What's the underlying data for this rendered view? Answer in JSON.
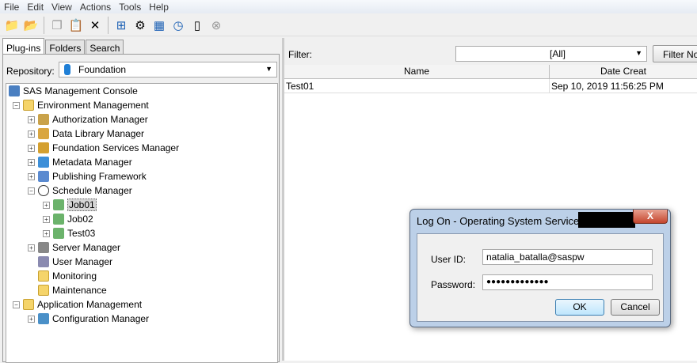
{
  "menu": [
    "File",
    "Edit",
    "View",
    "Actions",
    "Tools",
    "Help"
  ],
  "toolbar": [
    {
      "icon": "up-folder-icon",
      "g": "📁"
    },
    {
      "icon": "open-folder-icon",
      "g": "📂"
    },
    {
      "sep": true
    },
    {
      "icon": "copy-icon",
      "g": "❐"
    },
    {
      "icon": "paste-icon",
      "g": "📋"
    },
    {
      "icon": "delete-icon",
      "g": "✕"
    },
    {
      "sep": true
    },
    {
      "icon": "flow-icon",
      "g": "⊞"
    },
    {
      "icon": "gear-icon",
      "g": "⚙"
    },
    {
      "icon": "deploy-icon",
      "g": "▦"
    },
    {
      "icon": "clock-icon",
      "g": "◷"
    },
    {
      "icon": "server-icon",
      "g": "▯"
    },
    {
      "icon": "stop-icon",
      "g": "⊗"
    }
  ],
  "tabs": [
    "Plug-ins",
    "Folders",
    "Search"
  ],
  "repository": {
    "label": "Repository:",
    "value": "Foundation"
  },
  "tree": [
    {
      "label": "SAS Management Console",
      "level": 0,
      "exp": "",
      "icon": "console"
    },
    {
      "label": "Environment Management",
      "level": 1,
      "exp": "−",
      "icon": "folder"
    },
    {
      "label": "Authorization Manager",
      "level": 2,
      "exp": "+",
      "icon": "auth"
    },
    {
      "label": "Data Library Manager",
      "level": 2,
      "exp": "+",
      "icon": "lib"
    },
    {
      "label": "Foundation Services Manager",
      "level": 2,
      "exp": "+",
      "icon": "svc"
    },
    {
      "label": "Metadata Manager",
      "level": 2,
      "exp": "+",
      "icon": "meta"
    },
    {
      "label": "Publishing Framework",
      "level": 2,
      "exp": "+",
      "icon": "pub"
    },
    {
      "label": "Schedule Manager",
      "level": 2,
      "exp": "−",
      "icon": "clock"
    },
    {
      "label": "Job01",
      "level": 3,
      "exp": "+",
      "icon": "job",
      "selected": true
    },
    {
      "label": "Job02",
      "level": 3,
      "exp": "+",
      "icon": "job"
    },
    {
      "label": "Test03",
      "level": 3,
      "exp": "+",
      "icon": "job"
    },
    {
      "label": "Server Manager",
      "level": 2,
      "exp": "+",
      "icon": "server"
    },
    {
      "label": "User Manager",
      "level": 2,
      "exp": "",
      "icon": "user"
    },
    {
      "label": "Monitoring",
      "level": 2,
      "exp": "",
      "icon": "folder"
    },
    {
      "label": "Maintenance",
      "level": 2,
      "exp": "",
      "icon": "folder"
    },
    {
      "label": "Application Management",
      "level": 1,
      "exp": "−",
      "icon": "folder"
    },
    {
      "label": "Configuration Manager",
      "level": 2,
      "exp": "+",
      "icon": "config"
    }
  ],
  "filter": {
    "label": "Filter:",
    "value": "[All]",
    "button": "Filter Now"
  },
  "table": {
    "columns": [
      "Name",
      "Date Creat"
    ],
    "rows": [
      [
        "Test01",
        "Sep 10, 2019 11:56:25 PM"
      ]
    ]
  },
  "dialog": {
    "title": "Log On - Operating System Services - u",
    "close": "X",
    "user_label": "User ID:",
    "user_value": "natalia_batalla@saspw",
    "password_label": "Password:",
    "password_value": "●●●●●●●●●●●●●",
    "ok": "OK",
    "cancel": "Cancel"
  }
}
